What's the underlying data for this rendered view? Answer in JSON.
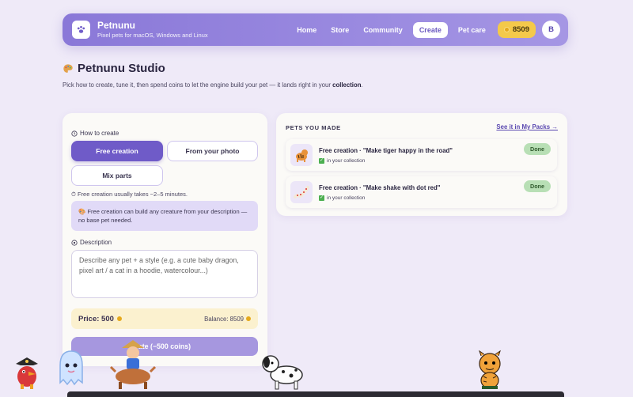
{
  "header": {
    "brand_name": "Petnunu",
    "tagline": "Pixel pets for macOS, Windows and Linux",
    "nav": [
      "Home",
      "Store",
      "Community",
      "Create",
      "Pet care"
    ],
    "active_nav": "Create",
    "coins": "8509",
    "avatar_initial": "B"
  },
  "page": {
    "title": "Petnunu Studio",
    "subtitle_pre": "Pick how to create, tune it, then spend coins to let the engine build your pet — it lands right in your ",
    "subtitle_bold": "collection",
    "subtitle_post": "."
  },
  "create": {
    "how_label": "How to create",
    "modes": [
      "Free creation",
      "From your photo",
      "Mix parts"
    ],
    "selected_mode": "Free creation",
    "time_hint": "Free creation usually takes ~2–5 minutes.",
    "info": "Free creation can build any creature from your description — no base pet needed.",
    "description_label": "Description",
    "description_placeholder": "Describe any pet + a style (e.g. a cute baby dragon, pixel art / a cat in a hoodie, watercolour...)",
    "price_label": "Price:",
    "price_value": "500",
    "balance_label": "Balance: 8509",
    "create_button": "ate (−500 coins)"
  },
  "pets": {
    "title": "PETS YOU MADE",
    "link": "See it in My Packs →",
    "items": [
      {
        "name": "Free creation · \"Make tiger happy in the road\"",
        "status": "in your collection",
        "badge": "Done"
      },
      {
        "name": "Free creation · \"Make shake with dot red\"",
        "status": "in your collection",
        "badge": "Done"
      }
    ]
  },
  "colors": {
    "accent": "#6f5bc8",
    "header_gradient_start": "#8a78d8",
    "coin": "#f4c94a",
    "done_badge": "#b8dfb5",
    "background": "#efeaf8"
  }
}
